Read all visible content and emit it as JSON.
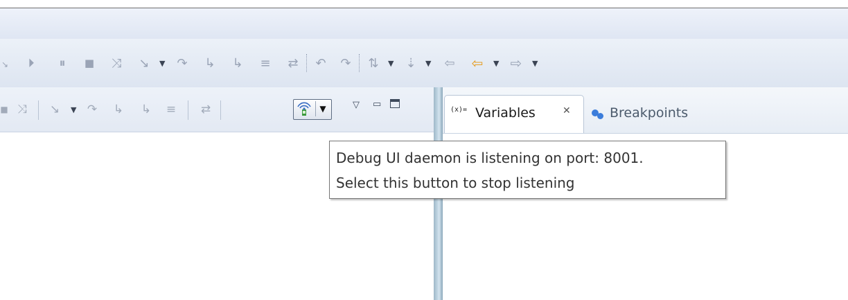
{
  "toolbar": {
    "glyphs": {
      "resume": "⏵",
      "suspend": "⏸",
      "terminate": "■",
      "disconnect": "⤨",
      "step_into": "↘",
      "step_over": "↷",
      "step_return": "↳",
      "drop_to_frame": "≡",
      "use_step_filters": "⇄",
      "undo": "↶",
      "redo": "↷",
      "open_type": "⇅",
      "next_annotation": "⇣",
      "back": "⇦",
      "forward": "⇨",
      "dropdown": "▼"
    }
  },
  "debug_view": {
    "toolbar_glyphs": {
      "remove": "■",
      "disconnect": "⤨",
      "step_into": "↘",
      "step_over": "↷",
      "step_return": "↳",
      "drop": "≡",
      "filters": "⇄",
      "dropdown": "▼",
      "view_menu": "▽",
      "minimize": "▭"
    },
    "daemon_button_icon": "antenna-icon"
  },
  "tabs": {
    "variables": {
      "icon": "(x)=",
      "label": "Variables",
      "close": "✕"
    },
    "breakpoints": {
      "label": "Breakpoints"
    }
  },
  "tooltip": {
    "line1": "Debug UI daemon is listening on port: 8001.",
    "line2": "Select this button to stop listening"
  },
  "colors": {
    "accent_blue": "#3c7ddb",
    "back_arrow": "#e59d21",
    "divider": "#9fb8c8"
  }
}
